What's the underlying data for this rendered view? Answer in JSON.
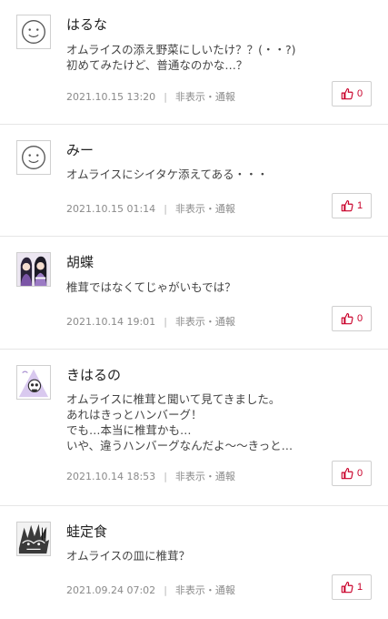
{
  "comments": [
    {
      "avatar": "default-face-icon",
      "name": "はるな",
      "lines": [
        "オムライスの添え野菜にしいたけ？？(・・?)",
        "初めてみたけど、普通なのかな…？"
      ],
      "date": "2021.10.15 13:20",
      "hide_report": "非表示・通報",
      "likes": "0"
    },
    {
      "avatar": "default-face-icon",
      "name": "みー",
      "lines": [
        "オムライスにシイタケ添えてある・・・"
      ],
      "date": "2021.10.15 01:14",
      "hide_report": "非表示・通報",
      "likes": "1"
    },
    {
      "avatar": "anime-character-avatar",
      "name": "胡蝶",
      "lines": [
        "椎茸ではなくてじゃがいもでは？"
      ],
      "date": "2021.10.14 19:01",
      "hide_report": "非表示・通報",
      "likes": "0"
    },
    {
      "avatar": "skull-character-avatar",
      "name": "きはるの",
      "lines": [
        "オムライスに椎茸と聞いて見てきました。",
        "あれはきっとハンバーグ！",
        "でも…本当に椎茸かも…",
        "いや、違うハンバーグなんだよ〜〜きっと…"
      ],
      "date": "2021.10.14 18:53",
      "hide_report": "非表示・通報",
      "likes": "0"
    },
    {
      "avatar": "manga-character-avatar",
      "name": "蛙定食",
      "lines": [
        "オムライスの皿に椎茸？"
      ],
      "date": "2021.09.24 07:02",
      "hide_report": "非表示・通報",
      "likes": "1"
    }
  ],
  "colors": {
    "like_accent": "#c9002a",
    "meta_text": "#8a8a8a",
    "divider": "#e6e6e6"
  }
}
